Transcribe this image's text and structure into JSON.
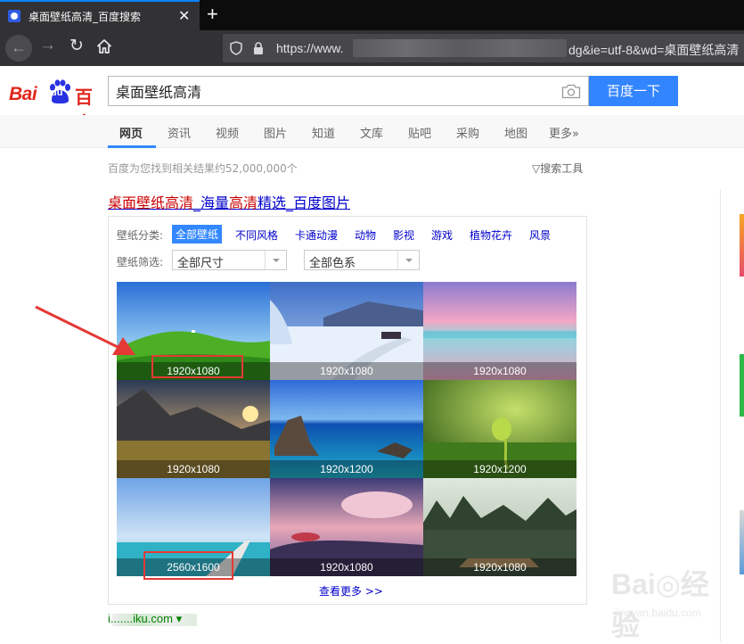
{
  "browser": {
    "tab_title": "桌面壁纸高清_百度搜索",
    "tab_close": "✕",
    "new_tab": "+",
    "url_prefix": "https://www.",
    "url_suffix": "dg&ie=utf-8&wd=桌面壁纸高清",
    "colors": {
      "chrome": "#323234",
      "accent": "#0a84ff"
    }
  },
  "baidu": {
    "logo_bai": "Bai",
    "logo_du": "du",
    "logo_cn": "百度",
    "search_value": "桌面壁纸高清",
    "search_button": "百度一下",
    "brand_color": "#3385ff"
  },
  "tabs": [
    "网页",
    "资讯",
    "视频",
    "图片",
    "知道",
    "文库",
    "贴吧",
    "采购",
    "地图",
    "更多»"
  ],
  "results_count": "百度为您找到相关结果约52,000,000个",
  "search_tools": "▽搜索工具",
  "result": {
    "title_hl1": "桌面壁纸高清",
    "title_plain1": "_海量",
    "title_hl2": "高清",
    "title_plain2": "精选_百度图片"
  },
  "card": {
    "category_label": "壁纸分类:",
    "categories": [
      "全部壁纸",
      "不同风格",
      "卡通动漫",
      "动物",
      "影视",
      "游戏",
      "植物花卉",
      "风景"
    ],
    "filter_label": "壁纸筛选:",
    "size_select": "全部尺寸",
    "color_select": "全部色系",
    "images": [
      {
        "scene": "green-hill",
        "size": "1920x1080"
      },
      {
        "scene": "snow-road",
        "size": "1920x1080"
      },
      {
        "scene": "pink-sea",
        "size": "1920x1080"
      },
      {
        "scene": "mountain-sunset",
        "size": "1920x1080"
      },
      {
        "scene": "blue-coast",
        "size": "1920x1200"
      },
      {
        "scene": "sprout",
        "size": "1920x1200"
      },
      {
        "scene": "pier-sky",
        "size": "2560x1600"
      },
      {
        "scene": "fantasy-land",
        "size": "1920x1080"
      },
      {
        "scene": "karst-raft",
        "size": "1920x1080"
      }
    ],
    "more": "查看更多 >>"
  },
  "annotation_color": "#e53935",
  "footer_url": "i.......iku.com ▾",
  "watermark": {
    "main": "Bai◎经验",
    "sub": "jingyan.baidu.com"
  }
}
